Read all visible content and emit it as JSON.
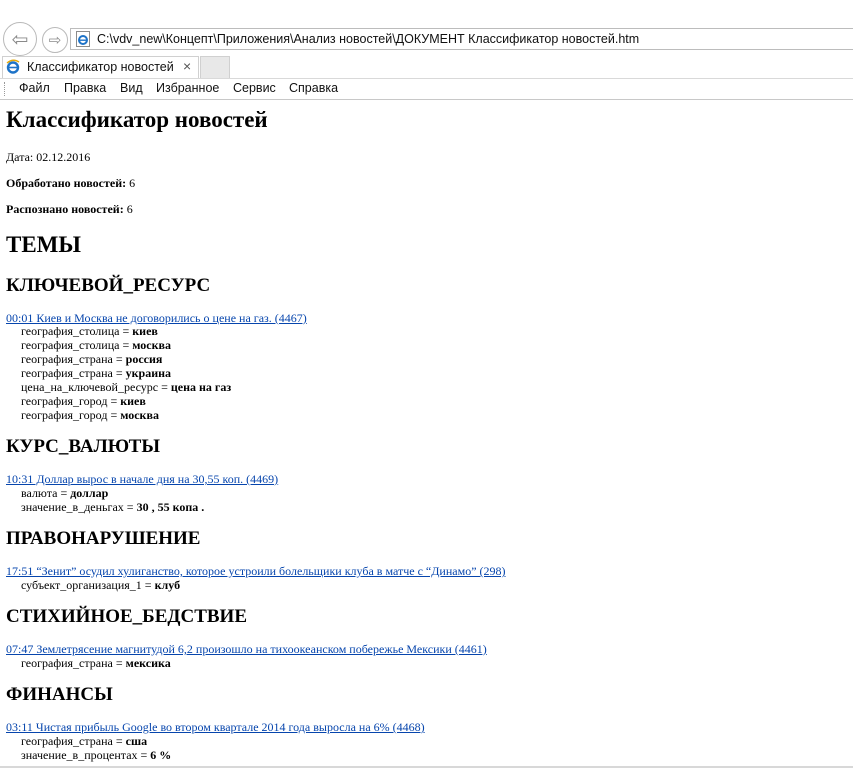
{
  "browser": {
    "url": "C:\\vdv_new\\Концепт\\Приложения\\Анализ новостей\\ДОКУМЕНТ Классификатор новостей.htm",
    "tab_title": "Классификатор новостей",
    "tab_close": "×",
    "menu": [
      "Файл",
      "Правка",
      "Вид",
      "Избранное",
      "Сервис",
      "Справка"
    ]
  },
  "doc": {
    "title": "Классификатор новостей",
    "date_label": "Дата:",
    "date_value": "02.12.2016",
    "processed_label": "Обработано новостей:",
    "processed_value": "6",
    "recognized_label": "Распознано новостей:",
    "recognized_value": "6",
    "themes_heading": "ТЕМЫ",
    "sections": [
      {
        "heading": "КЛЮЧЕВОЙ_РЕСУРС",
        "link": "00:01 Киев и Москва не договорились о цене на газ. (4467)",
        "attrs": [
          [
            "география_столица",
            "киев"
          ],
          [
            "география_столица",
            "москва"
          ],
          [
            "география_страна",
            "россия"
          ],
          [
            "география_страна",
            "украина"
          ],
          [
            "цена_на_ключевой_ресурс",
            "цена на газ"
          ],
          [
            "география_город",
            "киев"
          ],
          [
            "география_город",
            "москва"
          ]
        ]
      },
      {
        "heading": "КУРС_ВАЛЮТЫ",
        "link": "10:31 Доллар вырос в начале дня на 30,55 коп. (4469)",
        "attrs": [
          [
            "валюта",
            "доллар"
          ],
          [
            "значение_в_деньгах",
            "30 , 55 копа ."
          ]
        ]
      },
      {
        "heading": "ПРАВОНАРУШЕНИЕ",
        "link": "17:51 “Зенит” осудил хулиганство, которое устроили болельщики клуба в матче с “Динамо” (298)",
        "attrs": [
          [
            "субъект_организация_1",
            "клуб"
          ]
        ]
      },
      {
        "heading": "СТИХИЙНОЕ_БЕДСТВИЕ",
        "link": "07:47 Землетрясение магнитудой 6,2 произошло на тихоокеанском побережье Мексики (4461)",
        "attrs": [
          [
            "география_страна",
            "мексика"
          ]
        ]
      },
      {
        "heading": "ФИНАНСЫ",
        "link": "03:11 Чистая прибыль Google во втором квартале 2014 года выросла на 6% (4468)",
        "attrs": [
          [
            "география_страна",
            "сша"
          ],
          [
            "значение_в_процентах",
            "6 %"
          ]
        ]
      }
    ]
  }
}
